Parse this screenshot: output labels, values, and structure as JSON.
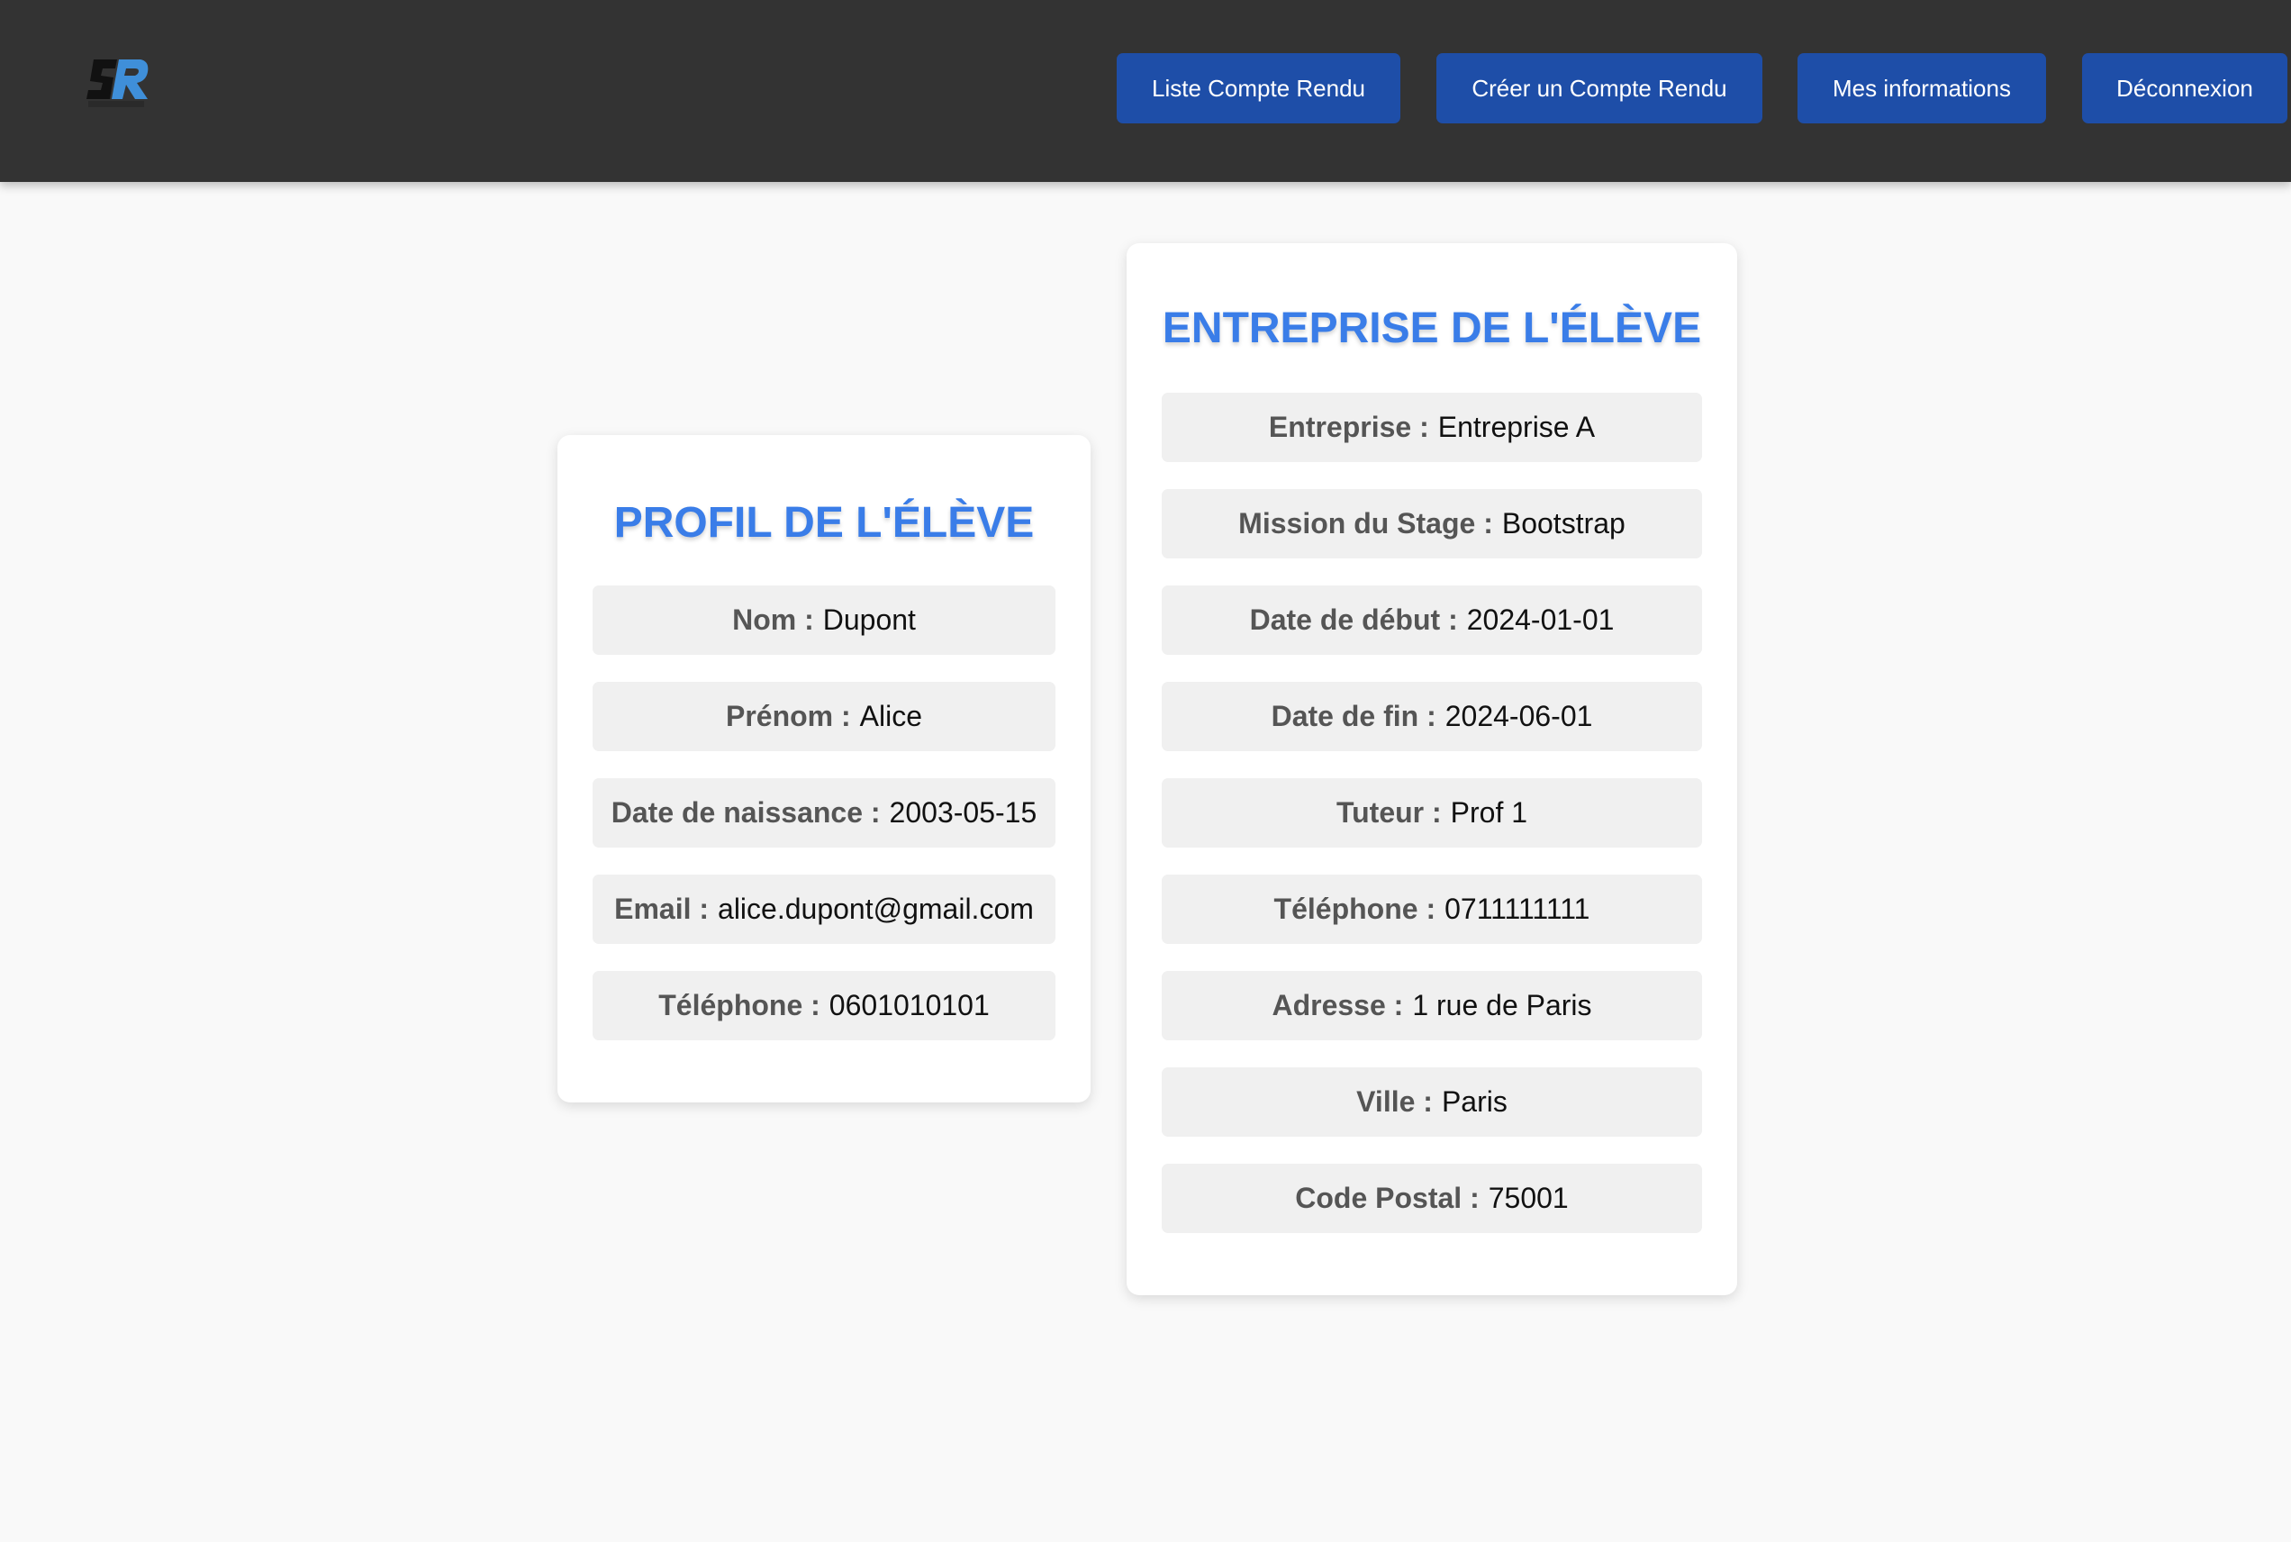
{
  "app": {
    "logo_icon": "sr-logo-icon"
  },
  "nav": {
    "items": [
      {
        "label": "Liste Compte Rendu"
      },
      {
        "label": "Créer un Compte Rendu"
      },
      {
        "label": "Mes informations"
      },
      {
        "label": "Déconnexion"
      }
    ]
  },
  "colors": {
    "topbar": "#333333",
    "nav_button": "#1e4ea8",
    "title": "#3a7de8",
    "field_bg": "#f0f0f0",
    "page_bg": "#f9f9f9"
  },
  "profile": {
    "title": "PROFIL DE L'ÉLÈVE",
    "fields": [
      {
        "label": "Nom :",
        "value": "Dupont"
      },
      {
        "label": "Prénom :",
        "value": "Alice"
      },
      {
        "label": "Date de naissance :",
        "value": "2003-05-15"
      },
      {
        "label": "Email :",
        "value": "alice.dupont@gmail.com"
      },
      {
        "label": "Téléphone :",
        "value": "0601010101"
      }
    ]
  },
  "company": {
    "title": "ENTREPRISE DE L'ÉLÈVE",
    "fields": [
      {
        "label": "Entreprise :",
        "value": "Entreprise A"
      },
      {
        "label": "Mission du Stage :",
        "value": "Bootstrap"
      },
      {
        "label": "Date de début :",
        "value": "2024-01-01"
      },
      {
        "label": "Date de fin :",
        "value": "2024-06-01"
      },
      {
        "label": "Tuteur :",
        "value": "Prof 1"
      },
      {
        "label": "Téléphone :",
        "value": "0711111111"
      },
      {
        "label": "Adresse :",
        "value": "1 rue de Paris"
      },
      {
        "label": "Ville :",
        "value": "Paris"
      },
      {
        "label": "Code Postal :",
        "value": "75001"
      }
    ]
  }
}
